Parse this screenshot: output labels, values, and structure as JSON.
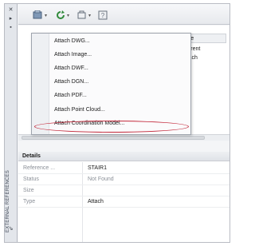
{
  "sidebar": {
    "label": "EXTERNAL REFERENCES"
  },
  "toolbar": {
    "icons": [
      "attach-dropdown-icon",
      "refresh-icon",
      "change-path-icon",
      "help-icon"
    ]
  },
  "list": {
    "columns": {
      "type": "Type"
    },
    "rows": [
      {
        "type": "Current"
      },
      {
        "type": "Attach"
      }
    ]
  },
  "menu": {
    "items": [
      "Attach DWG...",
      "Attach Image...",
      "Attach DWF...",
      "Attach DGN...",
      "Attach PDF...",
      "Attach Point Cloud...",
      "Attach Coordination Model..."
    ],
    "highlighted": "Attach Coordination Model...",
    "highlight_color": "#c3283a"
  },
  "details": {
    "title": "Details",
    "properties": [
      {
        "key": "Reference ...",
        "value": "STAIR1"
      },
      {
        "key": "Status",
        "value": "Not Found"
      },
      {
        "key": "Size",
        "value": ""
      },
      {
        "key": "Type",
        "value": "Attach"
      }
    ]
  }
}
